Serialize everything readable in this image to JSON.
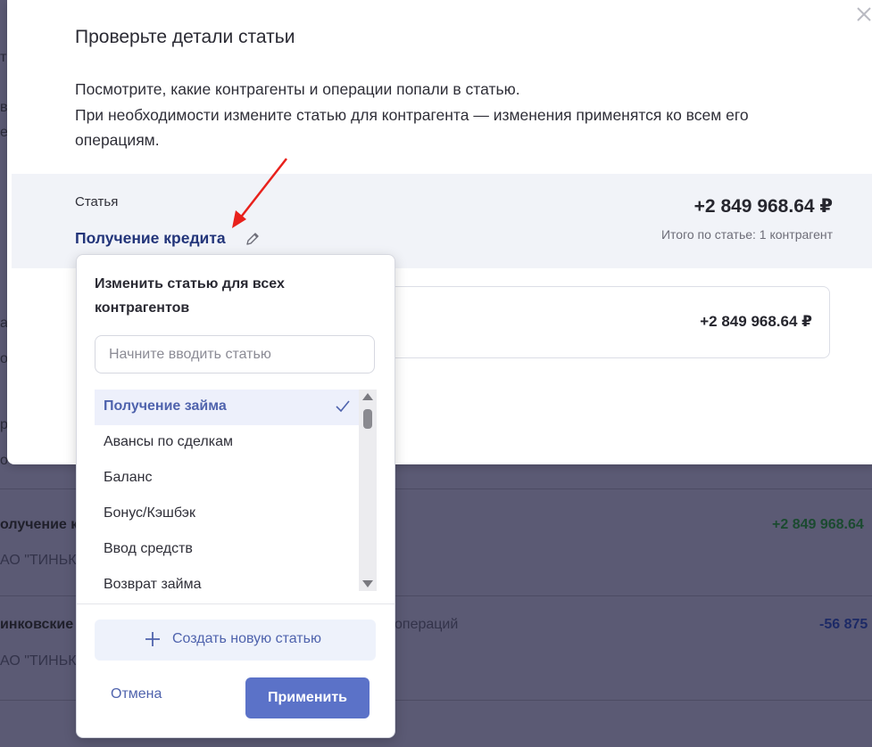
{
  "modal": {
    "title": "Проверьте детали статьи",
    "description_lines": [
      "Посмотрите, какие контрагенты и операции попали в статью.",
      "При необходимости измените статью для контрагента — изменения применятся ко всем его",
      "операциям."
    ],
    "article": {
      "label": "Статья",
      "name": "Получение кредита",
      "amount": "+2 849 968.64 ₽",
      "total_note": "Итого по статье: 1 контрагент"
    },
    "counterparty_card": {
      "amount": "+2 849 968.64 ₽"
    }
  },
  "popover": {
    "title": "Изменить статью для всех контрагентов",
    "search_placeholder": "Начните вводить статью",
    "items": [
      {
        "label": "Получение займа",
        "selected": true
      },
      {
        "label": "Авансы по сделкам",
        "selected": false
      },
      {
        "label": "Баланс",
        "selected": false
      },
      {
        "label": "Бонус/Кэшбэк",
        "selected": false
      },
      {
        "label": "Ввод средств",
        "selected": false
      },
      {
        "label": "Возврат займа",
        "selected": false
      }
    ],
    "create_label": "Создать новую статью",
    "cancel_label": "Отмена",
    "apply_label": "Применить"
  },
  "background": {
    "row1_title": "олучение кр",
    "row1_sub": "АО \"ТИНЬКО",
    "row1_amount": "+2 849 968.64",
    "row2_title": "инковские к",
    "row2_mid": "операций",
    "row2_sub": "АО \"ТИНЬКО",
    "row2_amount": "-56 875",
    "peek_1": "т",
    "peek_2": "в",
    "peek_3": "е",
    "peek_4": "а",
    "peek_5": "о",
    "peek_6": "р",
    "peek_7": "о"
  },
  "colors": {
    "accent": "#5b72c8",
    "link": "#4f63ad",
    "article_name": "#23357a",
    "annotation_arrow": "#e8211c",
    "overlay": "#5b5a74"
  },
  "icons": {
    "close": "close-icon",
    "pencil": "pencil-icon",
    "check": "check-icon",
    "plus": "plus-icon"
  }
}
